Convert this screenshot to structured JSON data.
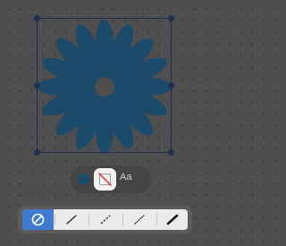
{
  "canvas": {
    "shape": {
      "type": "flower",
      "fill_color": "#1c4a6b",
      "petal_count": 16
    },
    "selection": {
      "color": "#1e2f52"
    }
  },
  "style_popover": {
    "fill_color": "#1c4a6b",
    "stroke_icon": "no-stroke-icon",
    "text_style_label": "Aa"
  },
  "line_style_toolbar": {
    "selected_color": "#3f7bd0",
    "options": [
      {
        "name": "none",
        "icon": "no-line-icon",
        "selected": true
      },
      {
        "name": "thin-solid",
        "icon": "thin-line-icon",
        "selected": false
      },
      {
        "name": "dashed",
        "icon": "dashed-line-icon",
        "selected": false
      },
      {
        "name": "dotted",
        "icon": "dotted-line-icon",
        "selected": false
      },
      {
        "name": "thick-solid",
        "icon": "thick-line-icon",
        "selected": false
      }
    ]
  }
}
